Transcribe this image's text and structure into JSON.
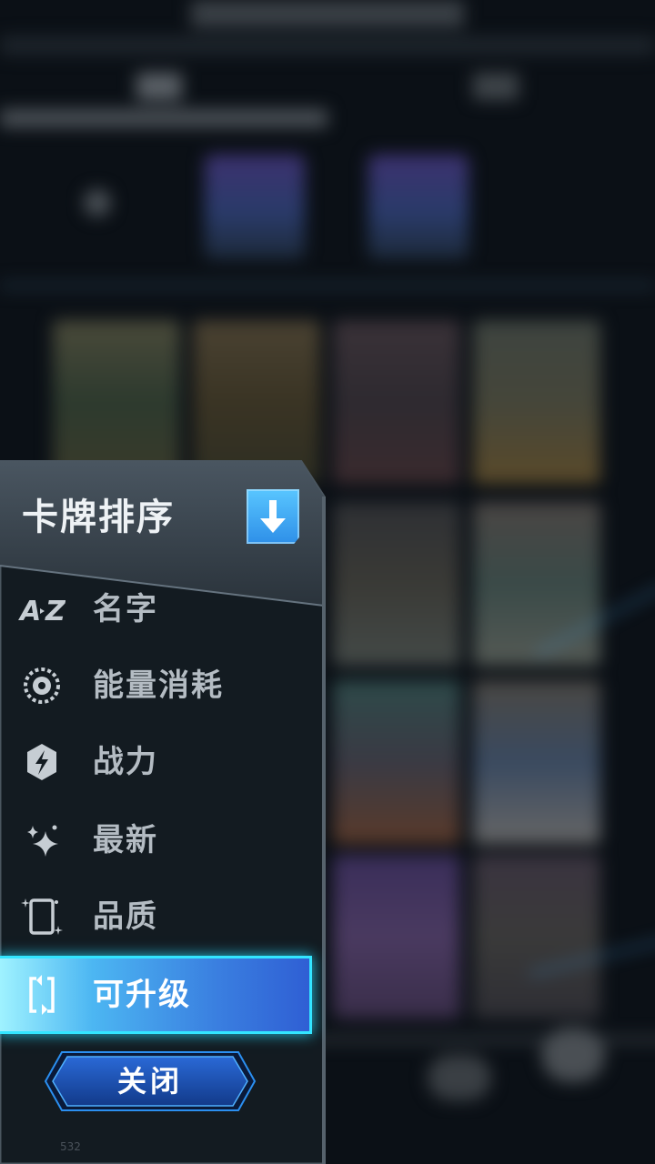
{
  "panel": {
    "title": "卡牌排序",
    "sort_direction_icon": "arrow-down-icon",
    "items": [
      {
        "label": "名字",
        "icon": "a-z-icon",
        "selected": false
      },
      {
        "label": "能量消耗",
        "icon": "energy-cost-icon",
        "selected": false
      },
      {
        "label": "战力",
        "icon": "power-shield-icon",
        "selected": false
      },
      {
        "label": "最新",
        "icon": "sparkle-icon",
        "selected": false
      },
      {
        "label": "品质",
        "icon": "quality-card-icon",
        "selected": false
      },
      {
        "label": "可升级",
        "icon": "upgradable-card-icon",
        "selected": true
      }
    ],
    "close_label": "关闭",
    "footer_number": "532"
  },
  "colors": {
    "panel_bg": "#141c22",
    "header_bg": "#3a4550",
    "selected_glow": "#33e5ff",
    "selected_fill": "#3a7fe0",
    "item_text": "#b4bcc3",
    "close_button": "#1b4fb0"
  }
}
